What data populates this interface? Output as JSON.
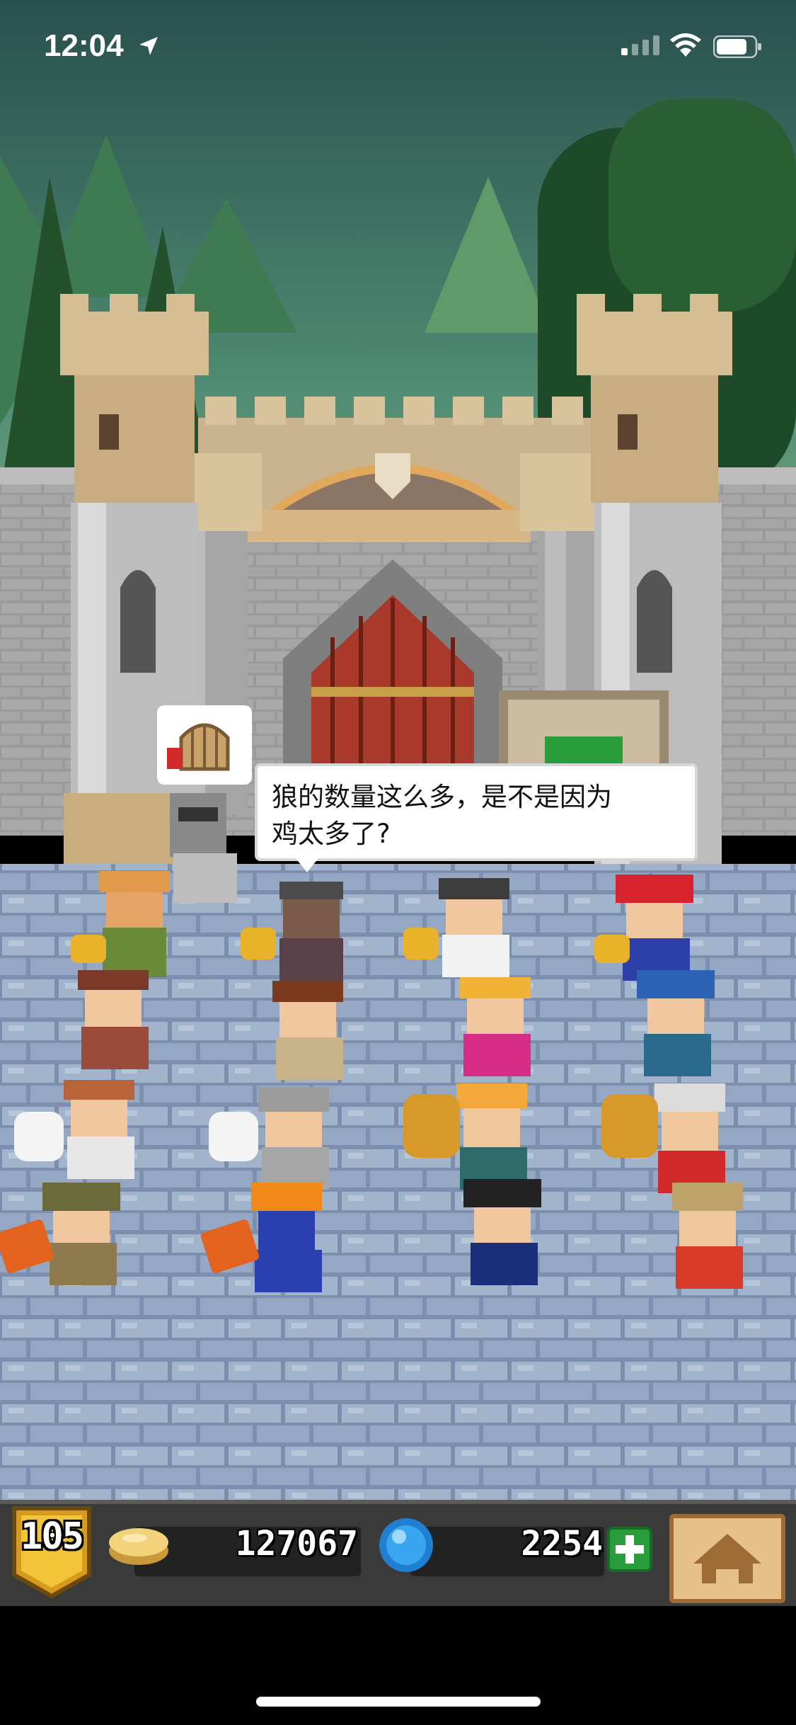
{
  "status_bar": {
    "time": "12:04",
    "icons": [
      "location-arrow-icon",
      "signal-icon",
      "wifi-icon",
      "battery-icon"
    ]
  },
  "scene": {
    "speech_bubble": {
      "line1": "狼的数量这么多，是不是因为",
      "line2": "鸡太多了?"
    },
    "sign_bubble_icon": "cage-icon"
  },
  "hud": {
    "level": "105",
    "gold": "127067",
    "gems": "2254",
    "icons": [
      "level-badge-icon",
      "gold-coin-icon",
      "gem-icon",
      "plus-icon",
      "home-icon"
    ]
  },
  "colors": {
    "sky_top": "#2c5a56",
    "sky_bottom": "#6aa882",
    "stone": "#9b9b9b",
    "floor": "#8fa3bf",
    "hud": "#3a3a3a",
    "accent_green": "#2b9d3c"
  }
}
